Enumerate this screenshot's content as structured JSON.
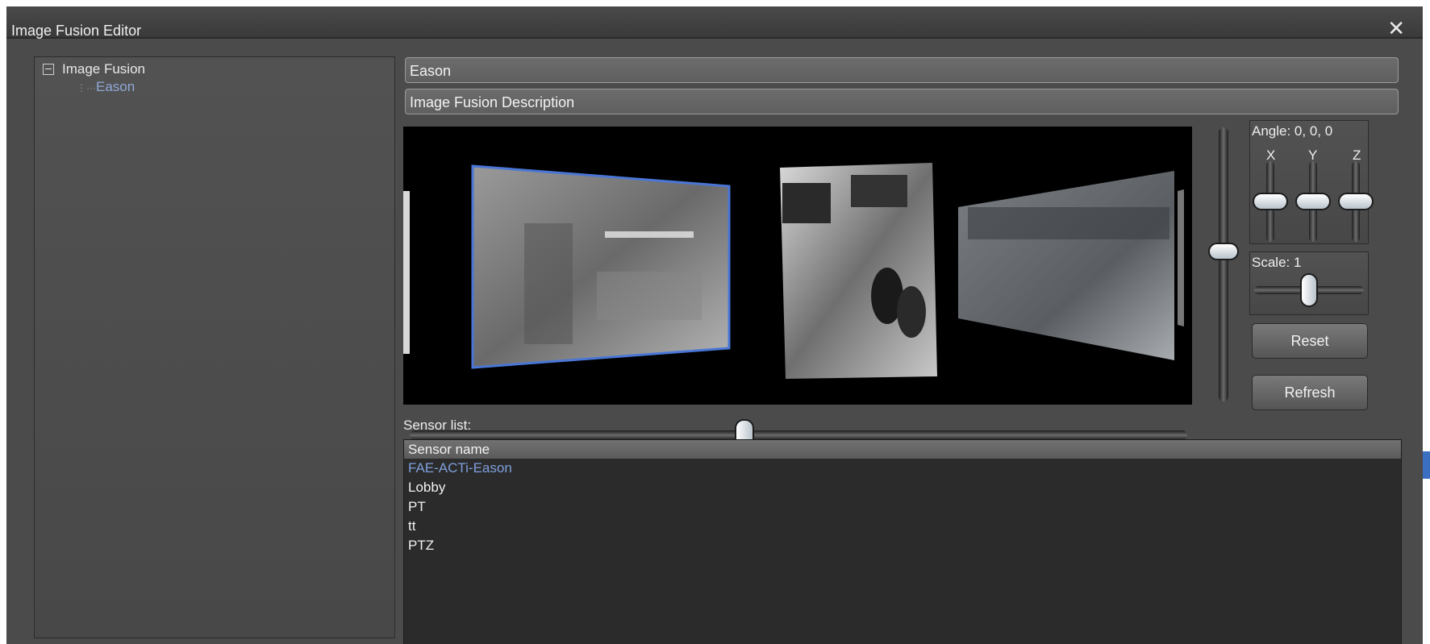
{
  "window": {
    "title": "Image Fusion Editor",
    "close_glyph": "✕"
  },
  "tree": {
    "root_label": "Image Fusion",
    "child_label": "Eason",
    "connector": "⋮···"
  },
  "fields": {
    "name_value": "Eason",
    "description_value": "Image Fusion Description"
  },
  "transform": {
    "angle_label": "Angle: 0, 0, 0",
    "axis_x": "X",
    "axis_y": "Y",
    "axis_z": "Z",
    "scale_label": "Scale: 1",
    "vertical_slider_value": 0.45,
    "horizontal_slider_value": 0.43,
    "x_slider_value": 0.5,
    "y_slider_value": 0.5,
    "z_slider_value": 0.5,
    "scale_slider_value": 0.5
  },
  "buttons": {
    "reset": "Reset",
    "refresh": "Refresh"
  },
  "sensors": {
    "label": "Sensor list:",
    "column_header": "Sensor name",
    "items": [
      "FAE-ACTi-Eason",
      "Lobby",
      "PT",
      "tt",
      "PTZ"
    ],
    "selected_index": 0
  },
  "colors": {
    "window_bg": "#4b4b4b",
    "selection_accent": "#7f9fdc",
    "frame_highlight": "#4a76d6"
  },
  "icons": {
    "close": "close-icon",
    "expander": "collapse-icon"
  }
}
